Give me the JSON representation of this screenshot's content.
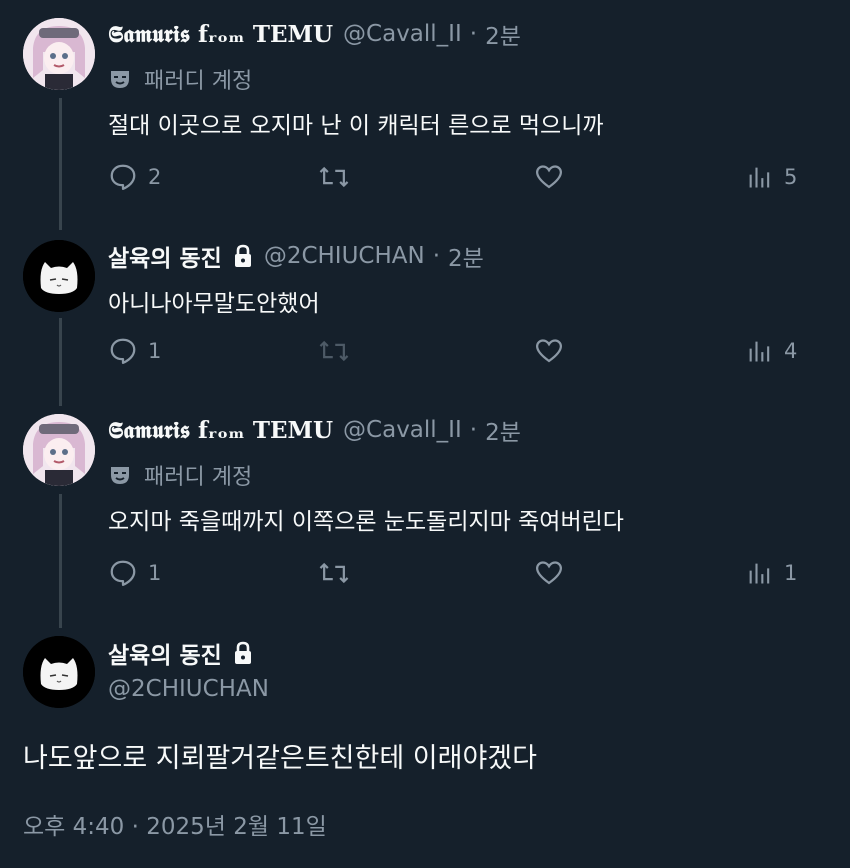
{
  "replies": [
    {
      "display_name": "𝕾𝖆𝖒𝖚𝖗𝖎𝖘 fᵣₒₘ TEMU",
      "handle": "@Cavall_II",
      "dot": "·",
      "time": "2분",
      "label": "패러디 계정",
      "text": "절대 이곳으로 오지마 난 이 캐릭터 른으로 먹으니까",
      "reply_count": "2",
      "view_count": "5"
    },
    {
      "display_name": "살육의 동진",
      "handle": "@2CHIUCHAN",
      "dot": "·",
      "time": "2분",
      "text": "아니나아무말도안했어",
      "reply_count": "1",
      "view_count": "4"
    },
    {
      "display_name": "𝕾𝖆𝖒𝖚𝖗𝖎𝖘 fᵣₒₘ TEMU",
      "handle": "@Cavall_II",
      "dot": "·",
      "time": "2분",
      "label": "패러디 계정",
      "text": "오지마 죽을때까지 이쪽으론 눈도돌리지마 죽여버린다",
      "reply_count": "1",
      "view_count": "1"
    }
  ],
  "main": {
    "display_name": "살육의 동진",
    "handle": "@2CHIUCHAN",
    "text": "나도앞으로 지뢰팔거같은트친한테 이래야겠다",
    "timestamp": "오후 4:40 · 2025년 2월 11일"
  },
  "icons": {
    "reply": "reply-icon",
    "retweet": "retweet-icon",
    "like": "like-icon",
    "views": "views-icon",
    "lock": "lock-icon",
    "parody": "parody-mask-icon"
  },
  "colors": {
    "background": "#15202b",
    "text": "#f7f9f9",
    "secondary": "#8b98a5",
    "thread_line": "#38444d"
  }
}
